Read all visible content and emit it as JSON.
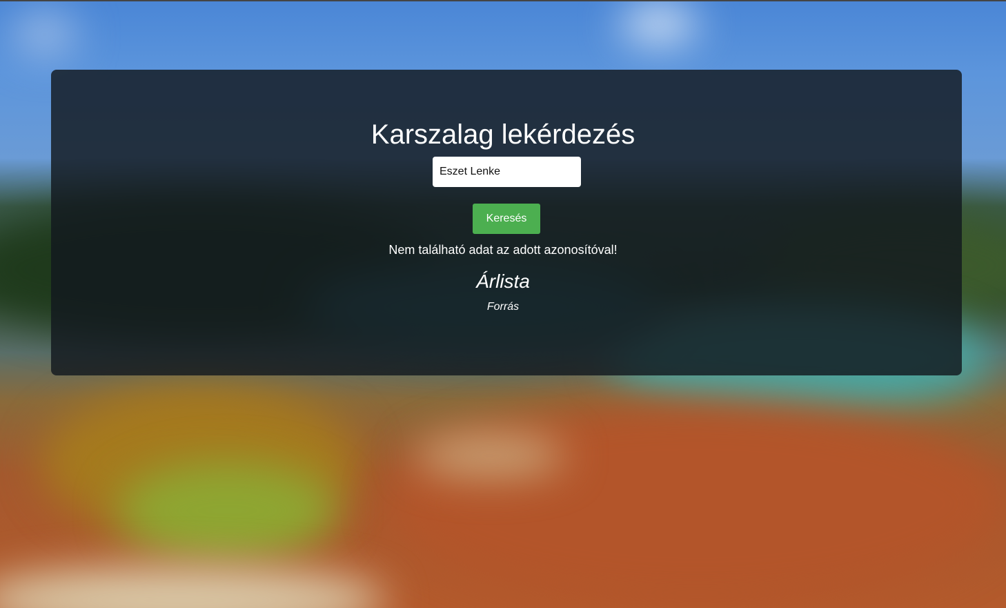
{
  "header": {
    "title": "Karszalag lekérdezés"
  },
  "search": {
    "value": "Eszet Lenke",
    "placeholder": "",
    "button_label": "Keresés"
  },
  "result": {
    "message": "Nem található adat az adott azonosítóval!"
  },
  "links": {
    "pricelist": "Árlista",
    "source": "Forrás"
  },
  "colors": {
    "button": "#4caf50",
    "card_overlay": "#12181e",
    "text": "#ffffff"
  }
}
